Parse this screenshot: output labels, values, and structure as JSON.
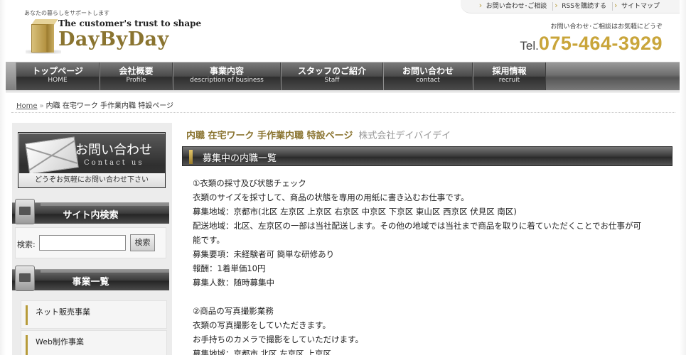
{
  "header": {
    "tagline": "あなたの暮らしをサポートします",
    "slogan": "The customer's trust to shape",
    "site_name": "DayByDay",
    "top_links": [
      "お問い合わせ･ご相談",
      "RSSを購読する",
      "サイトマップ"
    ],
    "contact_note": "お問い合わせ･ご相談はお気軽にどうぞ",
    "tel_label": "Tel.",
    "tel_number": "075-464-3929"
  },
  "nav": [
    {
      "ja": "トップページ",
      "en": "HOME",
      "width": 118
    },
    {
      "ja": "会社概要",
      "en": "Profile",
      "width": 103
    },
    {
      "ja": "事業内容",
      "en": "description of business",
      "width": 152
    },
    {
      "ja": "スタッフのご紹介",
      "en": "Staff",
      "width": 144
    },
    {
      "ja": "お問い合わせ",
      "en": "contact",
      "width": 126
    },
    {
      "ja": "採用情報",
      "en": "recruit",
      "width": 103
    }
  ],
  "breadcrumb": {
    "home": "Home",
    "sep": "»",
    "current": "内職 在宅ワーク 手作業内職 特設ページ"
  },
  "sidebar": {
    "contact_banner": {
      "title": "お問い合わせ",
      "subtitle": "Contact us",
      "bar_text": "どうぞお気軽にお問い合わせ下さい"
    },
    "search": {
      "heading": "サイト内検索",
      "label": "検索:",
      "input_value": "",
      "button": "検索"
    },
    "business": {
      "heading": "事業一覧",
      "items": [
        "ネット販売事業",
        "Web制作事業"
      ]
    }
  },
  "main": {
    "title": "内職 在宅ワーク 手作業内職 特設ページ",
    "company": "株式会社デイバイデイ",
    "section_heading": "募集中の内職一覧",
    "lines": [
      "①衣類の採寸及び状態チェック",
      "衣類のサイズを採寸して、商品の状態を専用の用紙に書き込むお仕事です。",
      "募集地域：京都市(北区 左京区 上京区 右京区 中京区 下京区 東山区 西京区 伏見区 南区)",
      "配送地域：北区、左京区の一部は当社配送します。その他の地域では当社まで商品を取りに着ていただくことでお仕事が可",
      "能です。",
      "募集要項：未経験者可 簡単な研修あり",
      "報酬：1着単価10円",
      "募集人数：随時募集中",
      "",
      "②商品の写真撮影業務",
      "衣類の写真撮影をしていただきます。",
      "お手持ちのカメラで撮影をしていただけます。",
      "募集地域：京都市 北区 左京区 上京区"
    ]
  },
  "colors": {
    "brand_gold": "#c9a53a",
    "brand_olive": "#8a7430",
    "nav_dark": "#2e2e2e"
  }
}
